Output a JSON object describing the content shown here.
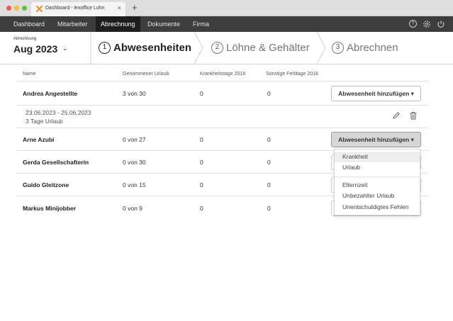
{
  "browser": {
    "tab_title": "Dashboard - lexoffice Lohn",
    "tab_close": "×",
    "new_tab": "+"
  },
  "nav": {
    "items": [
      "Dashboard",
      "Mitarbeiter",
      "Abrechnung",
      "Dokumente",
      "Firma"
    ],
    "active": "Abrechnung",
    "icons": [
      "help-icon",
      "settings-icon",
      "power-icon"
    ]
  },
  "header": {
    "period_label": "Abrechnung",
    "period_value": "Aug 2023",
    "period_chevron": "⌄",
    "steps": [
      {
        "number": "1",
        "label": "Abwesenheiten",
        "active": true
      },
      {
        "number": "2",
        "label": "Löhne & Gehälter",
        "active": false
      },
      {
        "number": "3",
        "label": "Abrechnen",
        "active": false
      }
    ]
  },
  "table": {
    "columns": [
      "Name",
      "Genommener Urlaub",
      "Krankheitstage 2018",
      "Sonstige Fehltage 2018"
    ],
    "rows": [
      {
        "name": "Andrea Angestellte",
        "urlaub": "3 von 30",
        "krank": "0",
        "sonstige": "0"
      },
      {
        "name": "Arne Azubi",
        "urlaub": "0 von 27",
        "krank": "0",
        "sonstige": "0"
      },
      {
        "name": "Gerda Gesellschafterin",
        "urlaub": "0 von 30",
        "krank": "0",
        "sonstige": "0"
      },
      {
        "name": "Guido Gleitzone",
        "urlaub": "0 von 15",
        "krank": "0",
        "sonstige": "0"
      },
      {
        "name": "Markus Minijobber",
        "urlaub": "0 von 9",
        "krank": "0",
        "sonstige": "0"
      }
    ],
    "add_button_label": "Abwesenheit hinzufügen ▾",
    "detail": {
      "date_range": "23.06.2023 - 25.06.2023",
      "summary": "3 Tage Urlaub"
    }
  },
  "dropdown": {
    "group1": [
      "Krankheit",
      "Urlaub"
    ],
    "group2": [
      "Elternzeit",
      "Unbezahlter Urlaub",
      "Unentschuldigtes Fehlen"
    ],
    "hovered": "Krankheit"
  },
  "colors": {
    "nav_bg": "#3d3d3d",
    "nav_active_bg": "#1e1e1e",
    "logo_orange": "#f08a24"
  }
}
